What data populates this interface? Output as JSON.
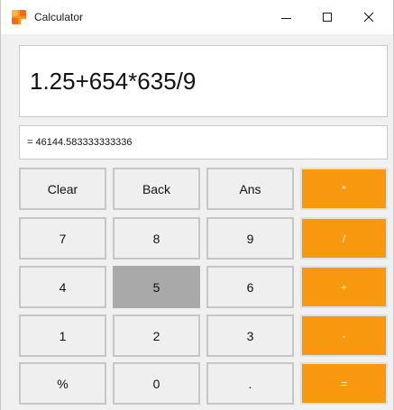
{
  "window": {
    "title": "Calculator"
  },
  "display": {
    "expression": "1.25+654*635/9",
    "result": "= 46144.583333333336"
  },
  "colors": {
    "operator_bg": "#f7980f",
    "button_bg": "#efefef",
    "pressed_bg": "#a9a9a9"
  },
  "buttons": {
    "clear": "Clear",
    "back": "Back",
    "ans": "Ans",
    "multiply": "*",
    "seven": "7",
    "eight": "8",
    "nine": "9",
    "divide": "/",
    "four": "4",
    "five": "5",
    "six": "6",
    "plus": "+",
    "one": "1",
    "two": "2",
    "three": "3",
    "minus": "-",
    "percent": "%",
    "zero": "0",
    "dot": ".",
    "equals": "="
  },
  "state": {
    "pressed_button": "5"
  }
}
